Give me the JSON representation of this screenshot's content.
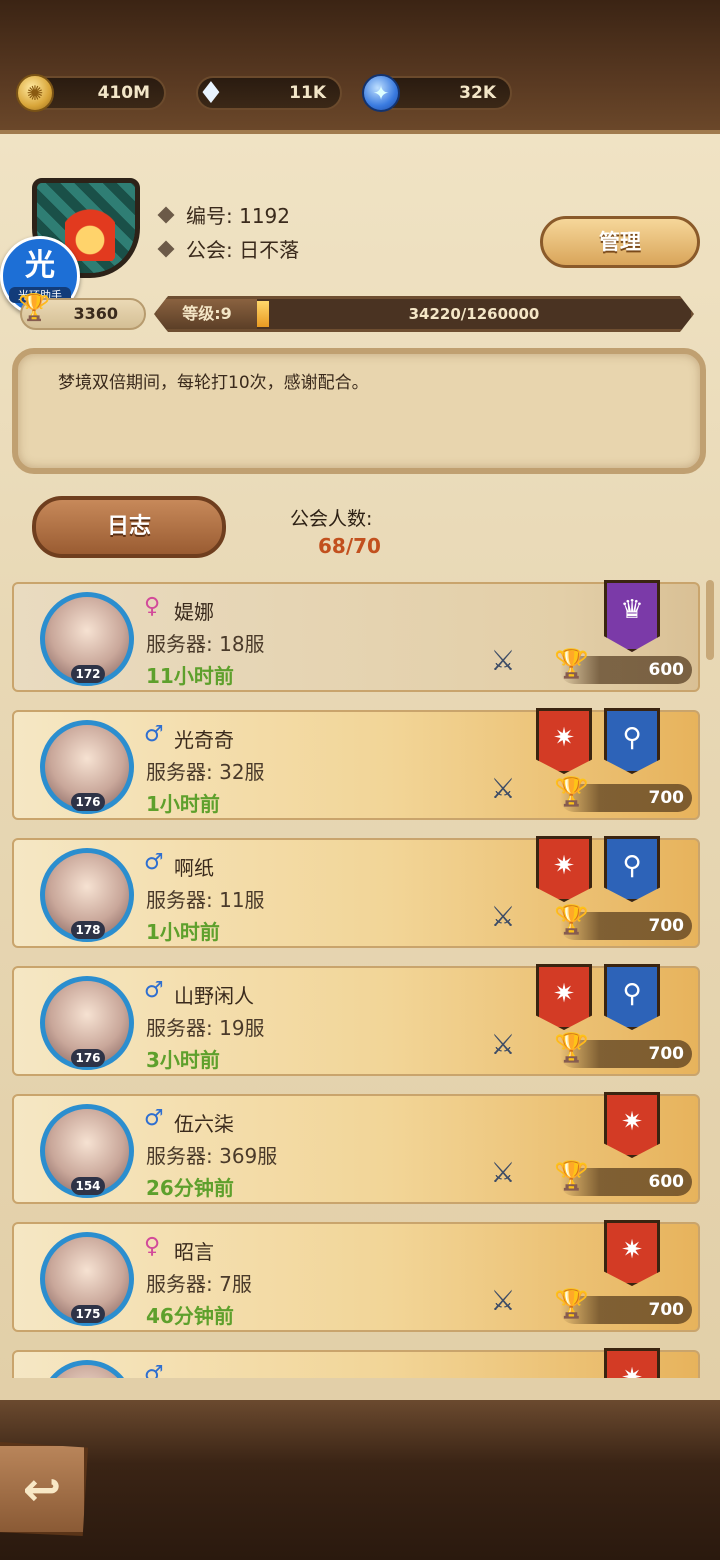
{
  "resources": {
    "gold": "410M",
    "diamonds": "11K",
    "scrolls": "32K"
  },
  "guild": {
    "id_label": "编号: 1192",
    "name_label": "公会: 日不落",
    "trophies": "3360",
    "level_label": "等级:9",
    "exp": "34220/1260000",
    "exp_progress": 0.027,
    "notice": "梦境双倍期间，每轮打10次，感谢配合。"
  },
  "helper_badge": {
    "big": "光",
    "small": "光环助手"
  },
  "buttons": {
    "manage": "管理",
    "log": "日志",
    "back_icon": "back-arrow-icon"
  },
  "member_count": {
    "label": "公会人数:",
    "value": "68/70"
  },
  "members": [
    {
      "name": "媞娜",
      "gender": "female",
      "level": "172",
      "server": "服务器: 18服",
      "time": "11小时前",
      "score": "600",
      "banners": [
        "purple"
      ]
    },
    {
      "name": "光奇奇",
      "gender": "male",
      "level": "176",
      "server": "服务器: 32服",
      "time": "1小时前",
      "score": "700",
      "banners": [
        "red",
        "blue"
      ]
    },
    {
      "name": "啊纸",
      "gender": "male",
      "level": "178",
      "server": "服务器: 11服",
      "time": "1小时前",
      "score": "700",
      "banners": [
        "red",
        "blue"
      ]
    },
    {
      "name": "山野闲人",
      "gender": "male",
      "level": "176",
      "server": "服务器: 19服",
      "time": "3小时前",
      "score": "700",
      "banners": [
        "red",
        "blue"
      ]
    },
    {
      "name": "伍六柒",
      "gender": "male",
      "level": "154",
      "server": "服务器: 369服",
      "time": "26分钟前",
      "score": "600",
      "banners": [
        "red"
      ]
    },
    {
      "name": "昭言",
      "gender": "female",
      "level": "175",
      "server": "服务器: 7服",
      "time": "46分钟前",
      "score": "700",
      "banners": [
        "red"
      ]
    },
    {
      "name": "",
      "gender": "male",
      "level": "",
      "server": "",
      "time": "",
      "score": "",
      "banners": [
        "red"
      ]
    }
  ],
  "colors": {
    "female": "#d24a9a",
    "male": "#2f6fd0",
    "time_green": "#5ea02c"
  }
}
